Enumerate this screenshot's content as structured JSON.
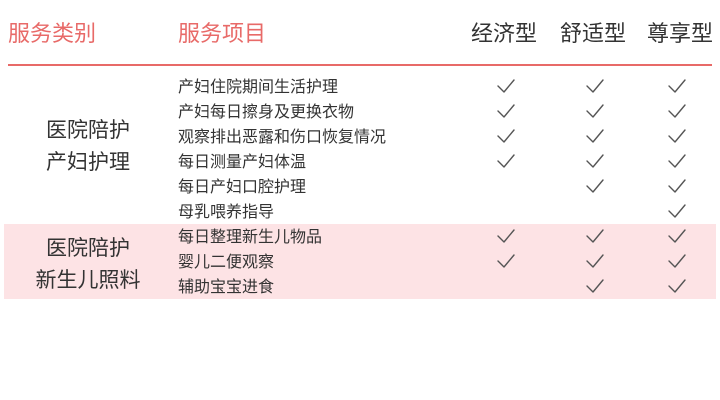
{
  "header": {
    "category": "服务类别",
    "item": "服务项目",
    "tiers": [
      "经济型",
      "舒适型",
      "尊享型"
    ]
  },
  "colors": {
    "accent": "#e86a68",
    "highlight_bg": "#fde3e5",
    "text": "#333333"
  },
  "sections": [
    {
      "category_lines": [
        "医院陪护",
        "产妇护理"
      ],
      "rows": [
        {
          "item": "产妇住院期间生活护理",
          "checks": [
            true,
            true,
            true
          ]
        },
        {
          "item": "产妇每日擦身及更换衣物",
          "checks": [
            true,
            true,
            true
          ]
        },
        {
          "item": "观察排出恶露和伤口恢复情况",
          "checks": [
            true,
            true,
            true
          ]
        },
        {
          "item": "每日测量产妇体温",
          "checks": [
            true,
            true,
            true
          ]
        },
        {
          "item": "每日产妇口腔护理",
          "checks": [
            false,
            true,
            true
          ]
        },
        {
          "item": "母乳喂养指导",
          "checks": [
            false,
            false,
            true
          ]
        }
      ]
    },
    {
      "category_lines": [
        "医院陪护",
        "新生儿照料"
      ],
      "rows": [
        {
          "item": "每日整理新生儿物品",
          "checks": [
            true,
            true,
            true
          ]
        },
        {
          "item": "婴儿二便观察",
          "checks": [
            true,
            true,
            true
          ]
        },
        {
          "item": "辅助宝宝进食",
          "checks": [
            false,
            true,
            true
          ]
        }
      ]
    }
  ]
}
